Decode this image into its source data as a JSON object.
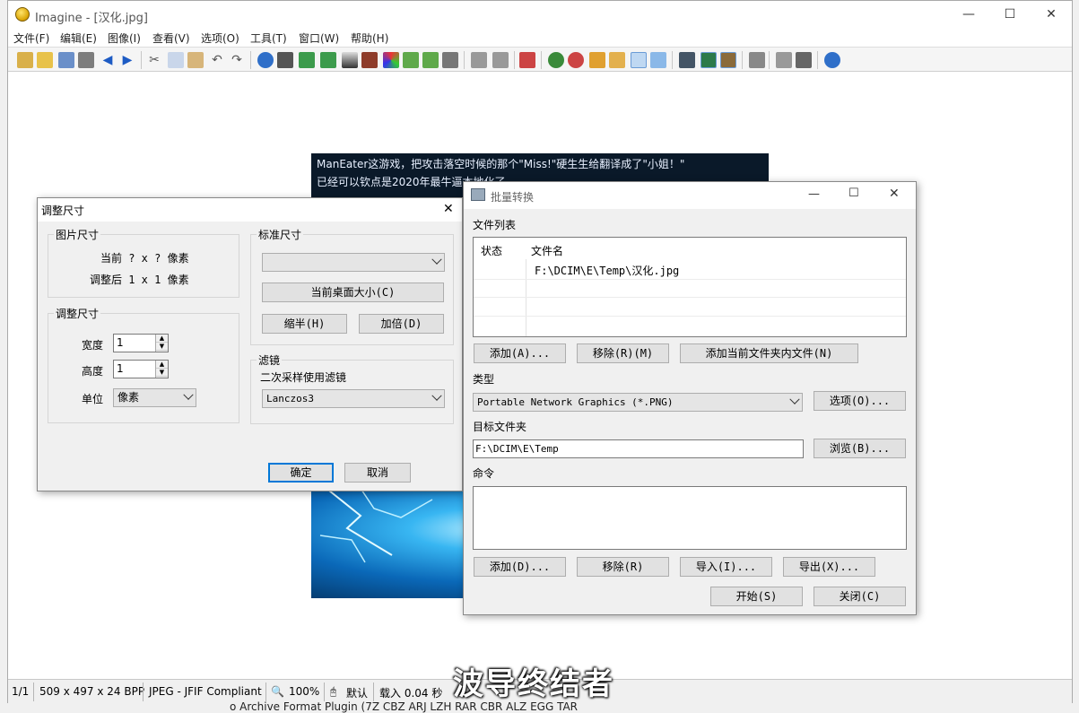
{
  "window": {
    "title": "Imagine - [汉化.jpg]",
    "min": "—",
    "max": "☐",
    "close": "✕"
  },
  "menu": [
    "文件(F)",
    "编辑(E)",
    "图像(I)",
    "查看(V)",
    "选项(O)",
    "工具(T)",
    "窗口(W)",
    "帮助(H)"
  ],
  "image": {
    "caption_lines": [
      "ManEater这游戏，把攻击落空时候的那个\"Miss!\"硬生生给翻译成了\"小姐！\"",
      "已经可以钦点是2020年最牛逼本地化了"
    ]
  },
  "resize_dialog": {
    "title": "调整尺寸",
    "close": "✕",
    "image_size_group": "图片尺寸",
    "current": "当前 ? x ? 像素",
    "after": "调整后 1 x 1 像素",
    "resize_group": "调整尺寸",
    "width_label": "宽度",
    "width_value": "1",
    "height_label": "高度",
    "height_value": "1",
    "unit_label": "单位",
    "unit_value": "像素",
    "std_size_group": "标准尺寸",
    "std_size_value": "",
    "desktop_btn": "当前桌面大小(C)",
    "half_btn": "缩半(H)",
    "double_btn": "加倍(D)",
    "filter_group": "滤镜",
    "filter_label": "二次采样使用滤镜",
    "filter_value": "Lanczos3",
    "ok": "确定",
    "cancel": "取消"
  },
  "batch_dialog": {
    "title": "批量转换",
    "min": "—",
    "max": "☐",
    "close": "✕",
    "file_list_label": "文件列表",
    "col_status": "状态",
    "col_filename": "文件名",
    "files": [
      {
        "status": "",
        "name": "F:\\DCIM\\E\\Temp\\汉化.jpg"
      }
    ],
    "add_btn": "添加(A)...",
    "remove_btn": "移除(R)(M)",
    "add_folder_btn": "添加当前文件夹内文件(N)",
    "type_label": "类型",
    "type_value": "Portable Network Graphics (*.PNG)",
    "options_btn": "选项(O)...",
    "target_label": "目标文件夹",
    "target_value": "F:\\DCIM\\E\\Temp",
    "browse_btn": "浏览(B)...",
    "command_label": "命令",
    "cmd_add_btn": "添加(D)...",
    "cmd_remove_btn": "移除(R)",
    "import_btn": "导入(I)...",
    "export_btn": "导出(X)...",
    "start_btn": "开始(S)",
    "close_btn": "关闭(C)"
  },
  "status": {
    "page": "1/1",
    "dimensions": "509 x 497 x 24 BPP",
    "format": "JPEG - JFIF Compliant",
    "zoom": "100%",
    "mode": "默认",
    "load_time": "载入 0.04 秒"
  },
  "watermark": "波导终结者",
  "bottom_text": "o Archive Format Plugin (7Z CBZ ARJ LZH RAR CBR ALZ EGG TAR"
}
